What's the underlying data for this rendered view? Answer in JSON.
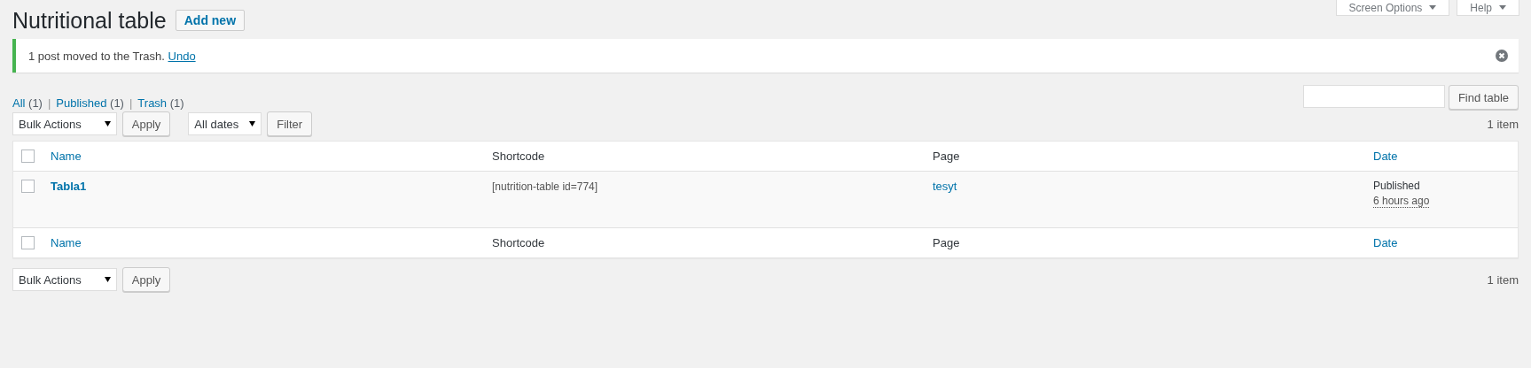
{
  "screen_meta": [
    {
      "label": "Screen Options"
    },
    {
      "label": "Help"
    }
  ],
  "page_title": "Nutritional table",
  "add_new": "Add new",
  "notice": {
    "text": "1 post moved to the Trash.",
    "link": "Undo"
  },
  "views": [
    {
      "label": "All",
      "count": "(1)",
      "selected": false,
      "separator": "|"
    },
    {
      "label": "Published",
      "count": "(1)",
      "selected": false,
      "separator": "|"
    },
    {
      "label": "Trash",
      "count": "(1)",
      "selected": false
    }
  ],
  "search": {
    "button": "Find table"
  },
  "tablenav_top": {
    "bulk_actions": "Bulk Actions",
    "apply": "Apply",
    "dates": "All dates",
    "filter": "Filter",
    "count": "1 item"
  },
  "table": {
    "columns": [
      {
        "label": "Name",
        "sortable": true
      },
      {
        "label": "Shortcode",
        "sortable": false
      },
      {
        "label": "Page",
        "sortable": false
      },
      {
        "label": "Date",
        "sortable": true
      }
    ],
    "select_all_checked": false,
    "rows": [
      {
        "name": "Tabla1",
        "shortcode": "[nutrition-table id=774]",
        "page": "tesyt",
        "status": "Published",
        "date": "6 hours ago",
        "checked": false
      }
    ],
    "footer_columns": [
      {
        "label": "Name",
        "sortable": true
      },
      {
        "label": "Shortcode",
        "sortable": false
      },
      {
        "label": "Page",
        "sortable": false
      },
      {
        "label": "Date",
        "sortable": true
      }
    ],
    "footer_select_all_checked": false
  },
  "tablenav_bottom": {
    "bulk_actions": "Bulk Actions",
    "apply": "Apply",
    "count": "1 item"
  }
}
